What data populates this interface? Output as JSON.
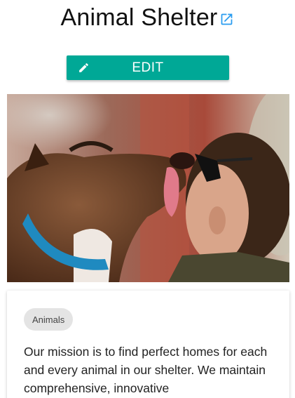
{
  "header": {
    "title": "Animal Shelter",
    "external_link_icon": "open-in-new-icon"
  },
  "actions": {
    "edit_label": "EDIT",
    "edit_icon": "pencil-icon"
  },
  "image": {
    "subject": "dog-licking-man-photo"
  },
  "card": {
    "chip_label": "Animals",
    "description": "Our mission is to find perfect homes for each and every animal in our shelter. We maintain comprehensive, innovative"
  },
  "colors": {
    "accent": "#00a896",
    "link_icon": "#2a9cf0",
    "chip_bg": "#e4e4e4"
  }
}
